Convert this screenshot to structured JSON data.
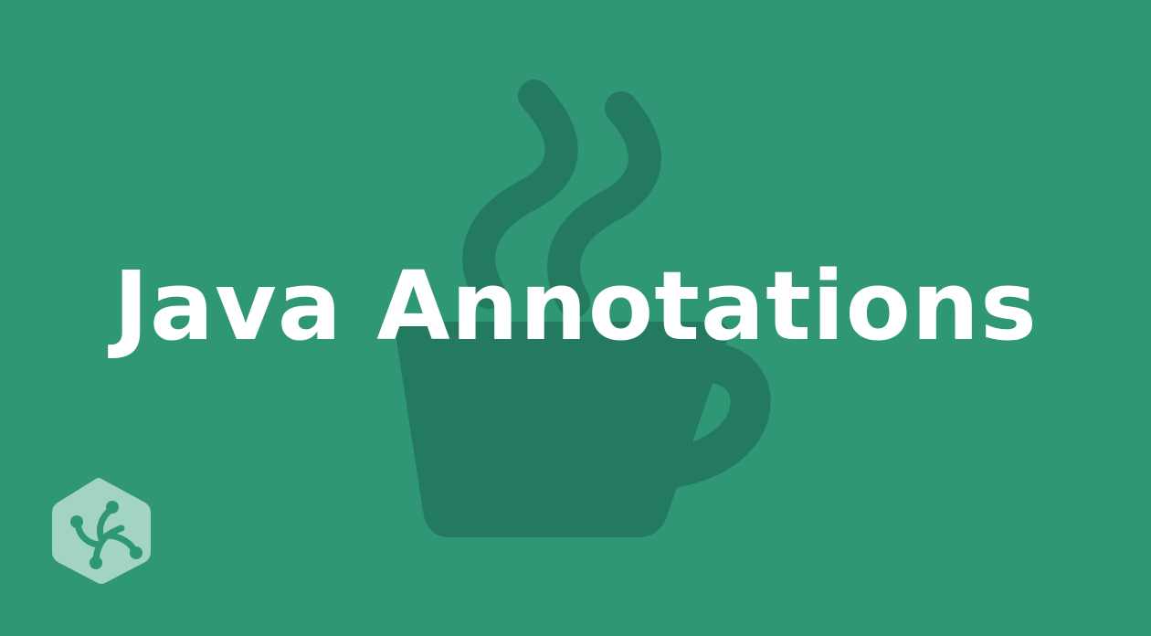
{
  "title": "Java Annotations",
  "icons": {
    "background": "coffee-cup-icon",
    "brand": "treehouse-logo-icon"
  },
  "colors": {
    "background": "#2f9676",
    "cup": "#247a61",
    "title": "#ffffff",
    "logo": "#a3d3c4"
  }
}
